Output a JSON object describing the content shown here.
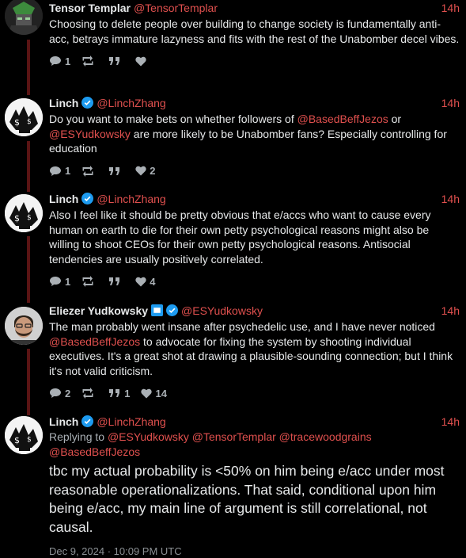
{
  "tweets": [
    {
      "name": "Tensor Templar",
      "handle": "@TensorTemplar",
      "time": "14h",
      "text": "Choosing to delete people over building to change society is fundamentally anti-acc, betrays immature lazyness and fits with the rest of the Unabomber decel vibes.",
      "replies": "1",
      "retweets": "",
      "quotes": "",
      "likes": ""
    },
    {
      "name": "Linch",
      "handle": "@LinchZhang",
      "time": "14h",
      "text_parts": [
        "Do you want to make bets on whether followers of ",
        "@BasedBeffJezos",
        " or ",
        "@ESYudkowsky",
        " are more likely to be Unabomber fans? Especially controlling for education"
      ],
      "replies": "1",
      "retweets": "",
      "quotes": "",
      "likes": "2"
    },
    {
      "name": "Linch",
      "handle": "@LinchZhang",
      "time": "14h",
      "text": "Also I feel like it should be pretty obvious that e/accs who want to cause every human on earth to die for their own petty psychological reasons might also be willing to shoot CEOs for their own petty psychological reasons. Antisocial tendencies are usually positively correlated.",
      "replies": "1",
      "retweets": "",
      "quotes": "",
      "likes": "4"
    },
    {
      "name": "Eliezer Yudkowsky",
      "handle": "@ESYudkowsky",
      "time": "14h",
      "text_parts": [
        "The man probably went insane after psychedelic use, and I have never noticed ",
        "@BasedBeffJezos",
        " to advocate for fixing the system by shooting individual executives.  It's a great shot at drawing a plausible-sounding connection; but I think it's not valid criticism."
      ],
      "replies": "2",
      "retweets": "",
      "quotes": "1",
      "likes": "14"
    }
  ],
  "main_tweet": {
    "name": "Linch",
    "handle": "@LinchZhang",
    "time": "14h",
    "replying_label": "Replying to",
    "replying_to": [
      "@ESYudkowsky",
      "@TensorTemplar",
      "@tracewoodgrains",
      "@BasedBeffJezos"
    ],
    "text": "tbc my actual probability is <50% on him being e/acc under most reasonable operationalizations. That said, conditional upon him being e/acc, my main line of argument is still correlational, not causal.",
    "date": "Dec 9, 2024 · 10:09 PM UTC"
  },
  "colors": {
    "accent": "#e0504e",
    "verified": "#1d9bf0",
    "thread_line": "#5a1414"
  }
}
